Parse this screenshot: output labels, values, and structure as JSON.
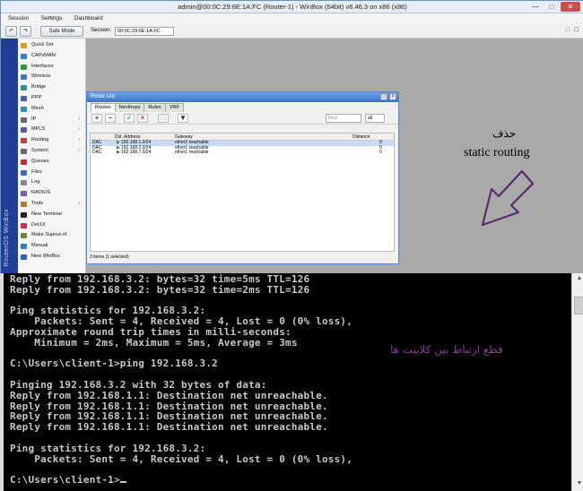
{
  "winbox": {
    "title": "admin@00:0C:29:6E:1A:FC (Router-1) - WinBox (64bit) v6.46.3 on x86 (x86)",
    "menu": [
      "Session",
      "Settings",
      "Dashboard"
    ],
    "toolbar": {
      "safe_mode_label": "Safe Mode",
      "session_label": "Session:",
      "session_value": "00:0C:29:6E:1A:FC"
    },
    "vertical_brand": "RouterOS WinBox",
    "sidebar": [
      {
        "label": "Quick Set",
        "icon": "quick-set-icon",
        "color": "#d9a020",
        "submenu": false
      },
      {
        "label": "CAPsMAN",
        "icon": "capsman-icon",
        "color": "#3a7ad0",
        "submenu": false
      },
      {
        "label": "Interfaces",
        "icon": "interfaces-icon",
        "color": "#2f9a3f",
        "submenu": false
      },
      {
        "label": "Wireless",
        "icon": "wireless-icon",
        "color": "#4d6ed0",
        "submenu": false
      },
      {
        "label": "Bridge",
        "icon": "bridge-icon",
        "color": "#2f8f8f",
        "submenu": false
      },
      {
        "label": "PPP",
        "icon": "ppp-icon",
        "color": "#4a5fb0",
        "submenu": false
      },
      {
        "label": "Mesh",
        "icon": "mesh-icon",
        "color": "#2d8fc4",
        "submenu": false
      },
      {
        "label": "IP",
        "icon": "ip-icon",
        "color": "#666666",
        "submenu": true
      },
      {
        "label": "MPLS",
        "icon": "mpls-icon",
        "color": "#5a5ab0",
        "submenu": true
      },
      {
        "label": "Routing",
        "icon": "routing-icon",
        "color": "#c04040",
        "submenu": true
      },
      {
        "label": "System",
        "icon": "system-icon",
        "color": "#6a6a6a",
        "submenu": true
      },
      {
        "label": "Queues",
        "icon": "queues-icon",
        "color": "#c03030",
        "submenu": false
      },
      {
        "label": "Files",
        "icon": "files-icon",
        "color": "#3a6ac0",
        "submenu": false
      },
      {
        "label": "Log",
        "icon": "log-icon",
        "color": "#888888",
        "submenu": false
      },
      {
        "label": "RADIUS",
        "icon": "radius-icon",
        "color": "#7a5ab0",
        "submenu": false
      },
      {
        "label": "Tools",
        "icon": "tools-icon",
        "color": "#b07a2a",
        "submenu": true
      },
      {
        "label": "New Terminal",
        "icon": "terminal-icon",
        "color": "#222222",
        "submenu": false
      },
      {
        "label": "Dot1X",
        "icon": "dot1x-icon",
        "color": "#c03050",
        "submenu": false
      },
      {
        "label": "Make Supout.rif",
        "icon": "supout-icon",
        "color": "#6a8a3a",
        "submenu": false
      },
      {
        "label": "Manual",
        "icon": "manual-icon",
        "color": "#3a7ac0",
        "submenu": false
      },
      {
        "label": "New WinBox",
        "icon": "new-winbox-icon",
        "color": "#3060c0",
        "submenu": false
      }
    ],
    "route_list": {
      "title": "Route List",
      "tabs": [
        "Routes",
        "Nexthops",
        "Rules",
        "VRF"
      ],
      "find_placeholder": "Find",
      "filter_value": "all",
      "columns": [
        "Dst. Address",
        "Gateway",
        "Distance"
      ],
      "rows": [
        {
          "flag": "DAC",
          "dst": "192.168.1.0/24",
          "gateway": "ether2 reachable",
          "distance": "0",
          "selected": true
        },
        {
          "flag": "DAC",
          "dst": "192.168.2.0/24",
          "gateway": "ether1 reachable",
          "distance": "0",
          "selected": false
        },
        {
          "flag": "DAC",
          "dst": "192.168.7.0/24",
          "gateway": "ether1 reachable",
          "distance": "0",
          "selected": false
        }
      ],
      "status": "3 items (1 selected)"
    },
    "annotation": {
      "arabic": "حذف",
      "english": "static routing"
    }
  },
  "console": {
    "lines": [
      "Reply from 192.168.3.2: bytes=32 time=5ms TTL=126",
      "Reply from 192.168.3.2: bytes=32 time=2ms TTL=126",
      "",
      "Ping statistics for 192.168.3.2:",
      "    Packets: Sent = 4, Received = 4, Lost = 0 (0% loss),",
      "Approximate round trip times in milli-seconds:",
      "    Minimum = 2ms, Maximum = 5ms, Average = 3ms",
      "",
      "C:\\Users\\client-1>ping 192.168.3.2",
      "",
      "Pinging 192.168.3.2 with 32 bytes of data:",
      "Reply from 192.168.1.1: Destination net unreachable.",
      "Reply from 192.168.1.1: Destination net unreachable.",
      "Reply from 192.168.1.1: Destination net unreachable.",
      "Reply from 192.168.1.1: Destination net unreachable.",
      "",
      "Ping statistics for 192.168.3.2:",
      "    Packets: Sent = 4, Received = 4, Lost = 0 (0% loss),",
      "",
      "C:\\Users\\client-1>"
    ],
    "annotation": "قطع ارتباط بین کلاینت ها"
  }
}
